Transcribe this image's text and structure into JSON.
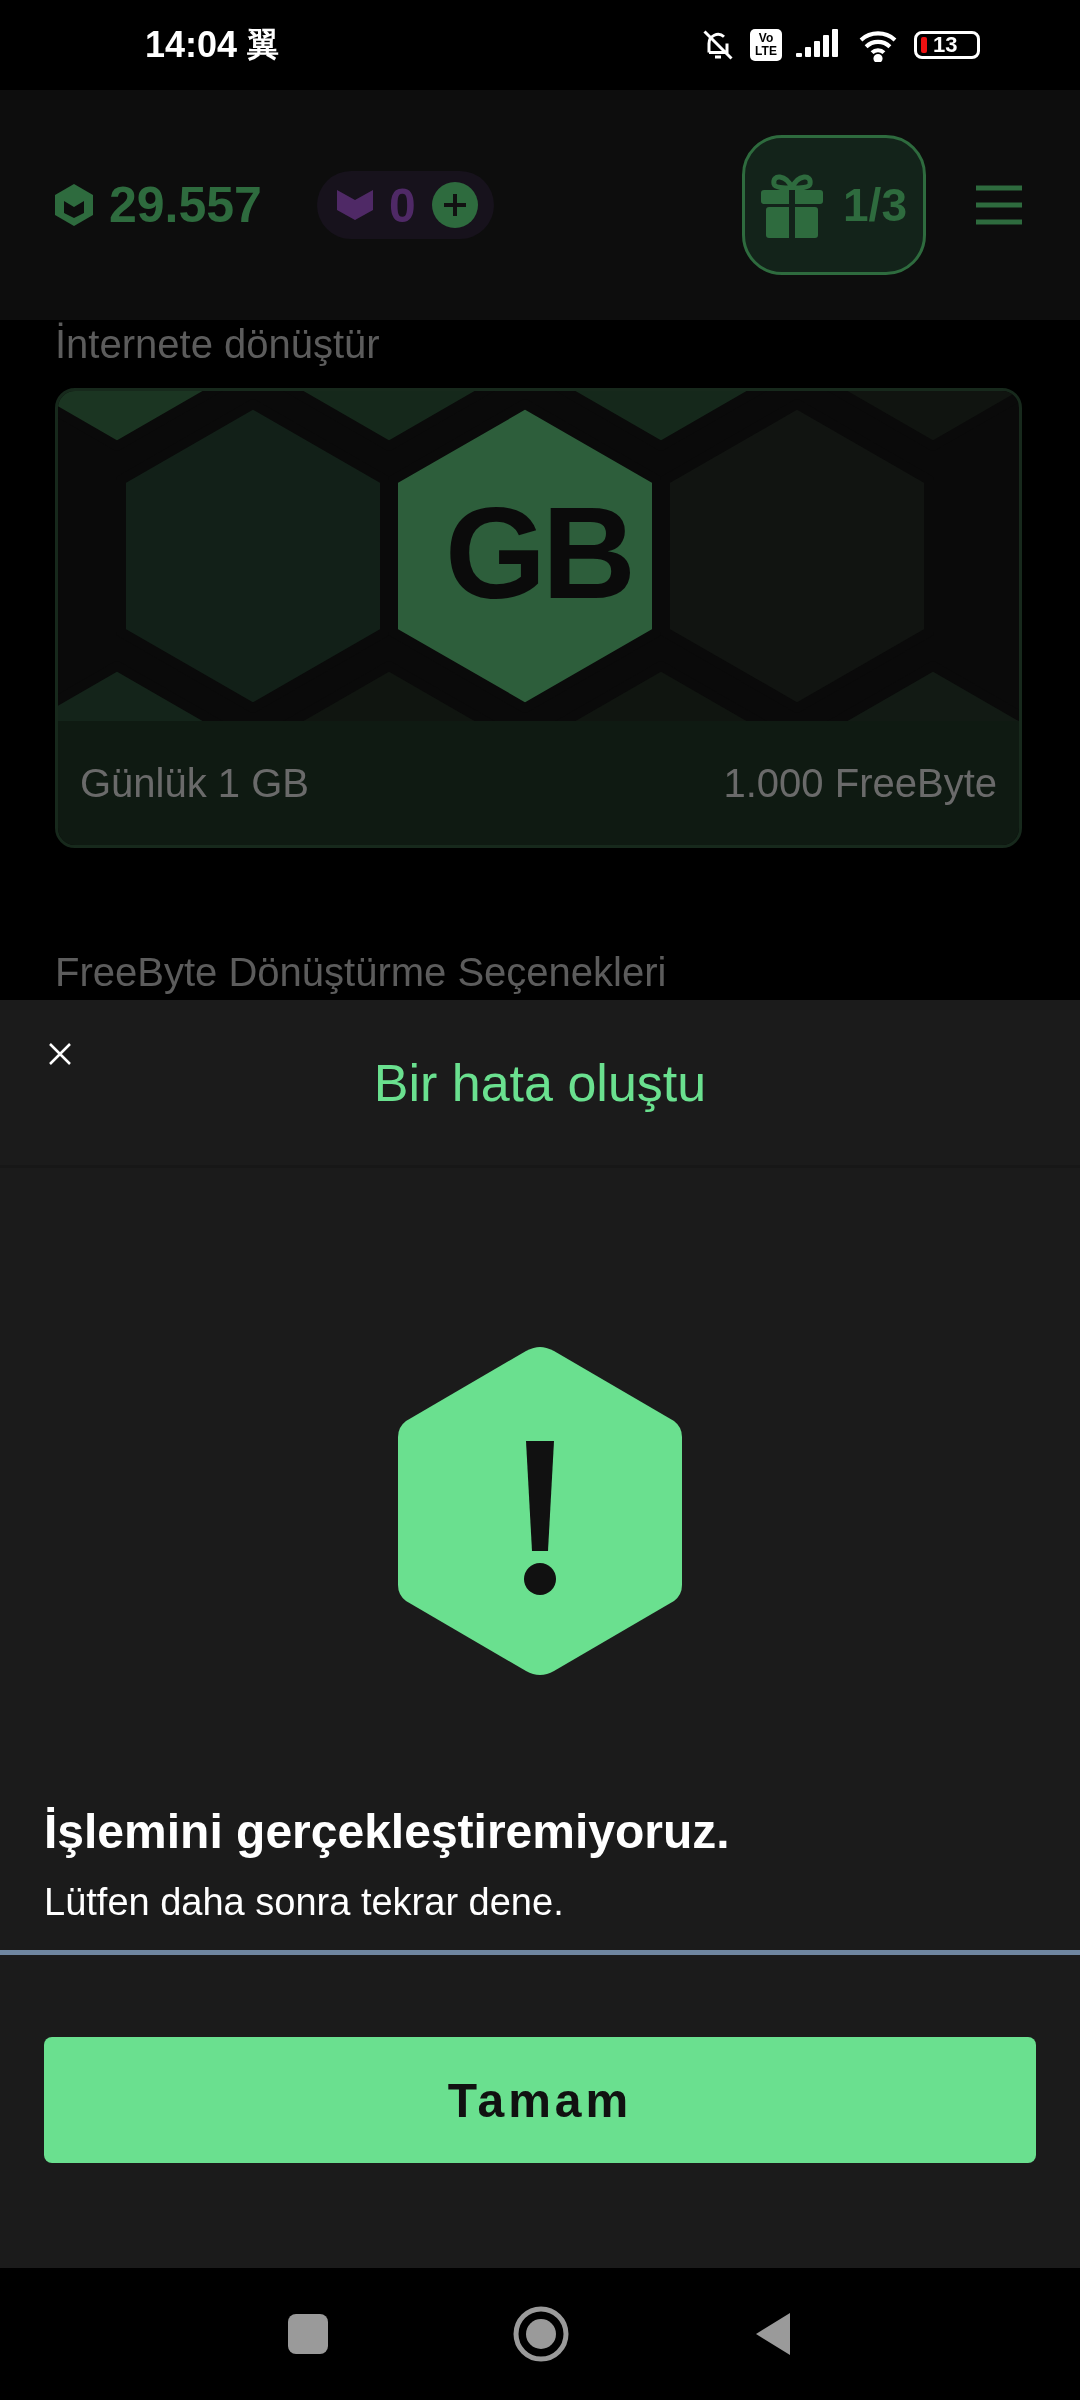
{
  "status_bar": {
    "time": "14:04",
    "carrier": "翼",
    "volte": [
      "Vo",
      "LTE"
    ],
    "battery": "13"
  },
  "header": {
    "balance": "29.557",
    "tokens": "0",
    "gift_progress": "1/3"
  },
  "background": {
    "section_title": "İnternete dönüştür",
    "card": {
      "badge": "GB",
      "name": "Günlük 1 GB",
      "price": "1.000 FreeByte"
    },
    "next_section_title": "FreeByte Dönüştürme Seçenekleri"
  },
  "dialog": {
    "title": "Bir hata oluştu",
    "heading": "İşlemini gerçekleştiremiyoruz.",
    "message": "Lütfen daha sonra tekrar dene.",
    "button": "Tamam"
  }
}
